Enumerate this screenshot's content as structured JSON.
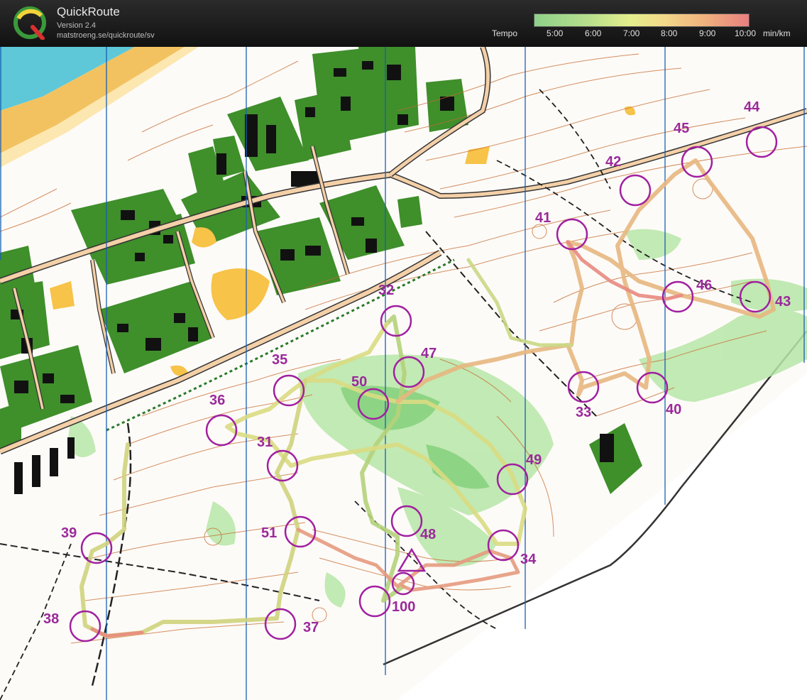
{
  "app": {
    "title": "QuickRoute",
    "version": "Version 2.4",
    "url": "matstroeng.se/quickroute/sv"
  },
  "legend": {
    "label": "Tempo",
    "ticks": [
      "5:00",
      "6:00",
      "7:00",
      "8:00",
      "9:00",
      "10:00"
    ],
    "unit": "min/km",
    "colors": {
      "fast": "#8fd18a",
      "mid": "#e5ee8c",
      "slow": "#e87f7f"
    }
  },
  "map": {
    "colors": {
      "water": "#5ec8d8",
      "sand": "#f3c260",
      "forest_green": "#3f8f2b",
      "open_land": "#f7c348",
      "contour": "#c56a2e",
      "vegetation": "#b7e6a8",
      "control": "#a020a0",
      "meridian": "#1a5fb4"
    },
    "controls": [
      {
        "id": "31",
        "label": "31"
      },
      {
        "id": "32",
        "label": "32"
      },
      {
        "id": "33",
        "label": "33"
      },
      {
        "id": "34",
        "label": "34"
      },
      {
        "id": "35",
        "label": "35"
      },
      {
        "id": "36",
        "label": "36"
      },
      {
        "id": "37",
        "label": "37"
      },
      {
        "id": "38",
        "label": "38"
      },
      {
        "id": "39",
        "label": "39"
      },
      {
        "id": "40",
        "label": "40"
      },
      {
        "id": "41",
        "label": "41"
      },
      {
        "id": "42",
        "label": "42"
      },
      {
        "id": "43",
        "label": "43"
      },
      {
        "id": "44",
        "label": "44"
      },
      {
        "id": "45",
        "label": "45"
      },
      {
        "id": "46",
        "label": "46"
      },
      {
        "id": "47",
        "label": "47"
      },
      {
        "id": "48",
        "label": "48"
      },
      {
        "id": "49",
        "label": "49"
      },
      {
        "id": "50",
        "label": "50"
      },
      {
        "id": "51",
        "label": "51"
      },
      {
        "id": "100",
        "label": "100"
      }
    ]
  }
}
